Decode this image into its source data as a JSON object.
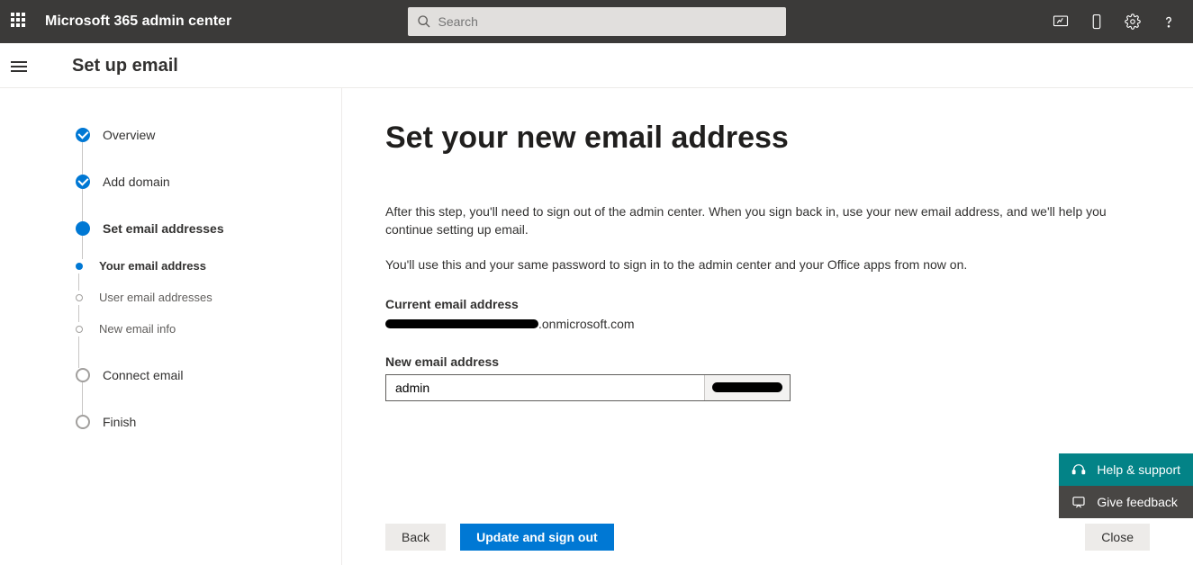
{
  "header": {
    "app_title": "Microsoft 365 admin center",
    "search_placeholder": "Search"
  },
  "page": {
    "title": "Set up email"
  },
  "steps": [
    {
      "label": "Overview",
      "state": "done"
    },
    {
      "label": "Add domain",
      "state": "done"
    },
    {
      "label": "Set email addresses",
      "state": "active",
      "substeps": [
        {
          "label": "Your email address",
          "state": "current"
        },
        {
          "label": "User email addresses",
          "state": "pending"
        },
        {
          "label": "New email info",
          "state": "pending"
        }
      ]
    },
    {
      "label": "Connect email",
      "state": "pending"
    },
    {
      "label": "Finish",
      "state": "pending"
    }
  ],
  "main": {
    "heading": "Set your new email address",
    "para1": "After this step, you'll need to sign out of the admin center. When you sign back in, use your new email address, and we'll help you continue setting up email.",
    "para2": "You'll use this and your same password to sign in to the admin center and your Office apps from now on.",
    "current_email_label": "Current email address",
    "current_email_suffix": ".onmicrosoft.com",
    "new_email_label": "New email address",
    "new_email_value": "admin"
  },
  "footer": {
    "back": "Back",
    "primary": "Update and sign out",
    "close": "Close"
  },
  "float": {
    "help": "Help & support",
    "feedback": "Give feedback"
  }
}
